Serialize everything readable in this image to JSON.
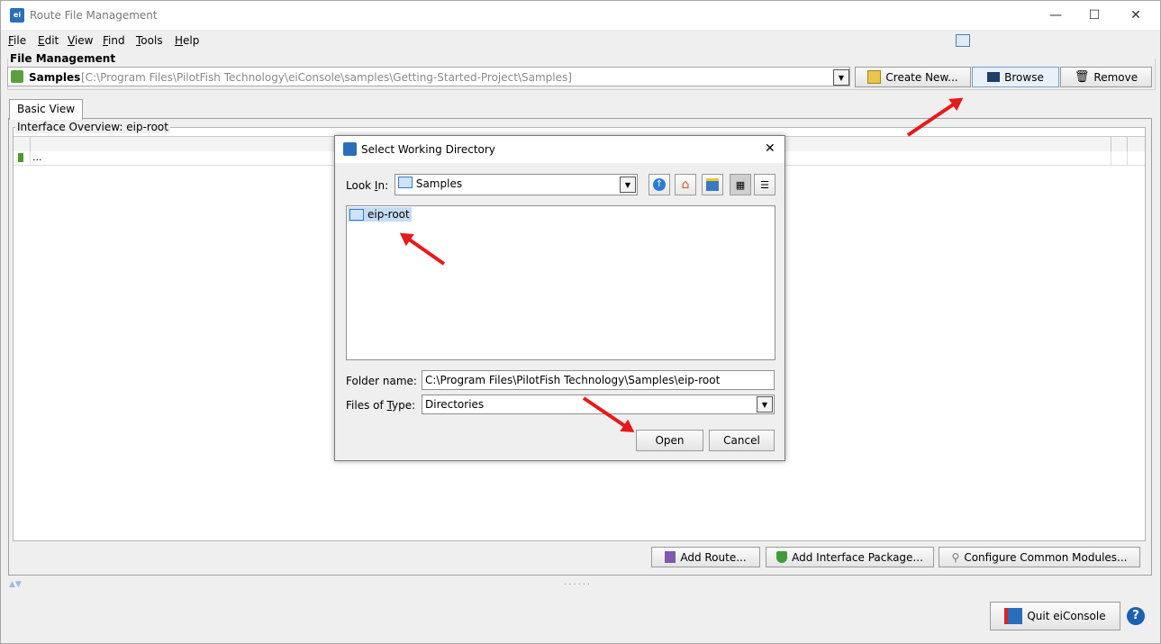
{
  "window": {
    "title": "Route File Management",
    "icon": "eiconsole-app-icon",
    "controls": {
      "minimize": "—",
      "maximize": "☐",
      "close": "✕"
    }
  },
  "menu": [
    "File",
    "Edit",
    "View",
    "Find",
    "Tools",
    "Help"
  ],
  "file_management": {
    "label": "File Management",
    "selected_name": "Samples",
    "selected_path": "[C:\\Program Files\\PilotFish Technology\\eiConsole\\samples\\Getting-Started-Project\\Samples]",
    "buttons": {
      "create_new": "Create New...",
      "browse": "Browse",
      "remove": "Remove"
    }
  },
  "tabs": [
    {
      "label": "Basic View",
      "active": true
    }
  ],
  "interface_overview": {
    "label": "Interface Overview: eip-root",
    "row_placeholder": "..."
  },
  "bottom_buttons": {
    "add_route": "Add Route...",
    "add_interface_package": "Add Interface Package...",
    "configure_common_modules": "Configure Common Modules...",
    "quit": "Quit eiConsole",
    "help": "?"
  },
  "dialog": {
    "title": "Select Working Directory",
    "close": "✕",
    "look_in_label": "Look In:",
    "look_in_value": "Samples",
    "toolbar_icons": [
      "up-folder-icon",
      "home-icon",
      "new-folder-icon",
      "list-view-icon",
      "details-view-icon"
    ],
    "files": [
      {
        "name": "eip-root",
        "selected": true
      }
    ],
    "folder_name_label": "Folder name:",
    "folder_name_value": "C:\\Program Files\\PilotFish Technology\\Samples\\eip-root",
    "files_of_type_label": "Files of Type:",
    "files_of_type_value": "Directories",
    "open_label": "Open",
    "cancel_label": "Cancel"
  },
  "colors": {
    "accent": "#2a6ebb",
    "annotation_arrow": "#e61a1a",
    "selection": "#c6dcf5"
  }
}
